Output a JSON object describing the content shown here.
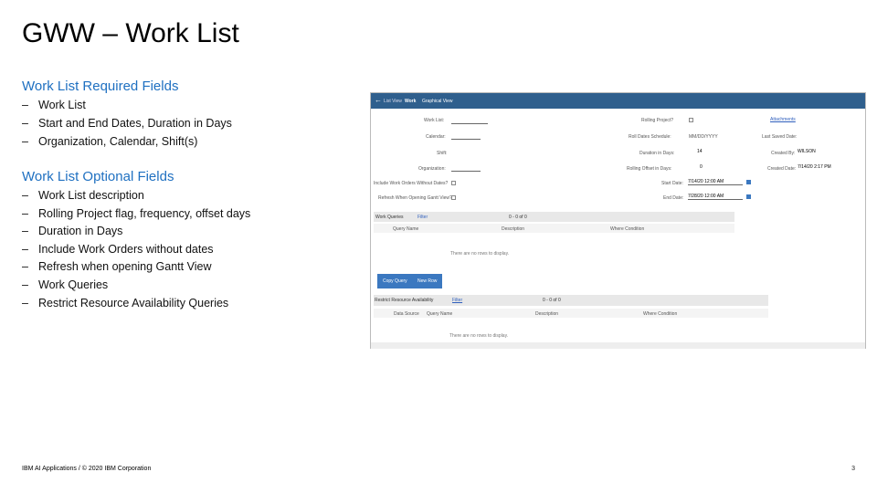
{
  "title": "GWW – Work List",
  "required": {
    "heading": "Work List Required Fields",
    "items": [
      "Work List",
      "Start and End Dates, Duration in Days",
      "Organization, Calendar, Shift(s)"
    ]
  },
  "optional": {
    "heading": "Work List Optional Fields",
    "items": [
      "Work List description",
      "Rolling Project flag, frequency, offset days",
      "Duration in Days",
      "Include Work Orders without dates",
      "Refresh when opening Gantt View",
      "Work Queries",
      "Restrict Resource Availability Queries"
    ]
  },
  "bullet": "–",
  "screenshot": {
    "tabs": [
      "List View",
      "Work",
      "Graphical View"
    ],
    "fields": {
      "work_list": "Work List:",
      "calendar": "Calendar:",
      "shift": "Shift:",
      "organization": "Organization:",
      "include_wo": "Include Work Orders Without Dates?",
      "refresh": "Refresh When Opening Gantt View?",
      "rolling": "Rolling Project?",
      "roll_dates": "Roll Dates Schedule:",
      "roll_dates_val": "MM/DD/YYYY",
      "duration": "Duration in Days:",
      "duration_val": "14",
      "rolling_offset": "Rolling Offset in Days:",
      "rolling_offset_val": "0",
      "start": "Start Date:",
      "start_val": "7/14/20 12:00 AM",
      "end": "End Date:",
      "end_val": "7/28/20 12:00 AM",
      "attachments": "Attachments",
      "last_saved": "Last Saved Date:",
      "created_by": "Created By:",
      "created_by_val": "WILSON",
      "created_date": "Created Date:",
      "created_date_val": "7/14/20 2:17 PM"
    },
    "queries": {
      "title": "Work Queries",
      "filter": "Filter",
      "pager": "0 - 0 of 0",
      "cols": [
        "Query Name",
        "Description",
        "Where Condition"
      ],
      "empty": "There are no rows to display.",
      "copy": "Copy Query",
      "new": "New Row"
    },
    "restrict": {
      "title": "Restrict Resource Availability",
      "filter": "Filter",
      "pager": "0 - 0 of 0",
      "cols": [
        "Data Source",
        "Query Name",
        "Description",
        "Where Condition"
      ],
      "empty": "There are no rows to display."
    }
  },
  "footer": "IBM AI Applications / © 2020 IBM Corporation",
  "page": "3"
}
